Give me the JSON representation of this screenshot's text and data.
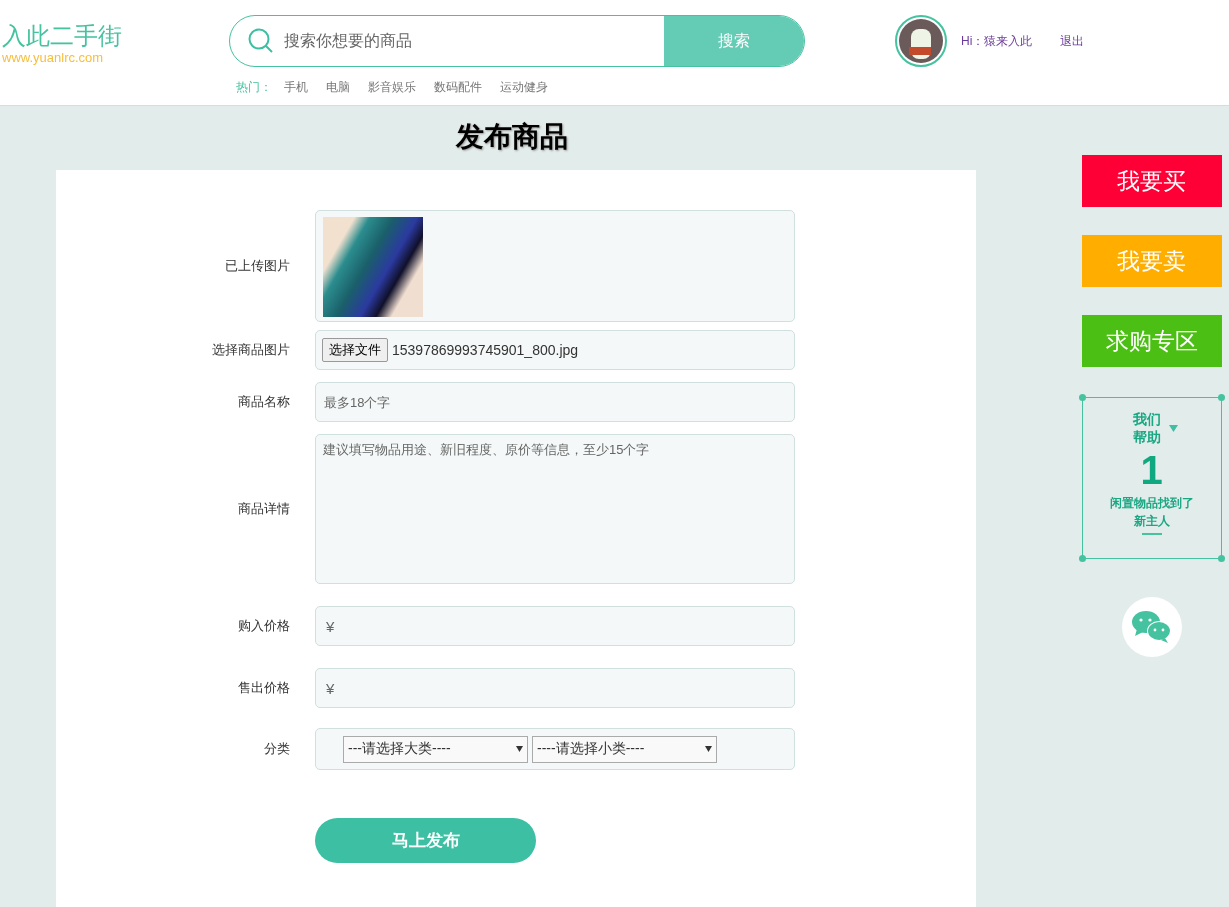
{
  "header": {
    "logo": "入此二手街",
    "logo_url": "www.yuanlrc.com",
    "search": {
      "placeholder": "搜索你想要的商品",
      "button": "搜索"
    },
    "hot_label": "热门：",
    "hot_items": [
      "手机",
      "电脑",
      "影音娱乐",
      "数码配件",
      "运动健身"
    ],
    "greeting": "Hi：猿来入此",
    "logout": "退出"
  },
  "page_title": "发布商品",
  "form": {
    "fields": [
      {
        "kind": "image",
        "label": "已上传图片"
      },
      {
        "kind": "file",
        "label": "选择商品图片",
        "button": "选择文件",
        "value": "15397869993745901_800.jpg"
      },
      {
        "kind": "text",
        "label": "商品名称",
        "placeholder": "最多18个字"
      },
      {
        "kind": "textarea",
        "label": "商品详情",
        "placeholder": "建议填写物品用途、新旧程度、原价等信息，至少15个字"
      },
      {
        "kind": "price",
        "label": "购入价格",
        "prefix": "¥"
      },
      {
        "kind": "price",
        "label": "售出价格",
        "prefix": "¥"
      },
      {
        "kind": "selects",
        "label": "分类",
        "options": [
          "---请选择大类----",
          "----请选择小类----"
        ]
      }
    ],
    "submit": "马上发布"
  },
  "sidebar": {
    "buttons": [
      {
        "label": "我要买",
        "color": "#ff0036"
      },
      {
        "label": "我要卖",
        "color": "#ffae00"
      },
      {
        "label": "求购专区",
        "color": "#4cbf14"
      }
    ],
    "stats": {
      "heading_1": "我们",
      "heading_2": "帮助",
      "count": "1",
      "caption_1": "闲置物品找到了",
      "caption_2": "新主人"
    }
  }
}
